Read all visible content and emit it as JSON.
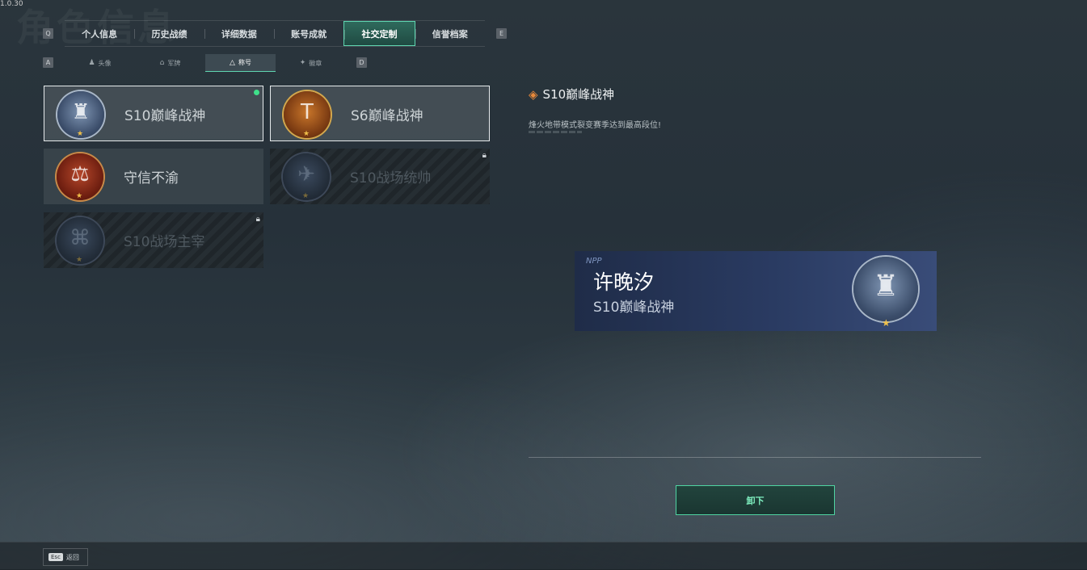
{
  "corner_text": "1.0.30",
  "ghost_title": "角色信息",
  "tab_keys": {
    "left": "Q",
    "right": "E"
  },
  "subtab_keys": {
    "left": "A",
    "right": "D"
  },
  "tabs": [
    {
      "label": "个人信息",
      "active": false
    },
    {
      "label": "历史战绩",
      "active": false
    },
    {
      "label": "详细数据",
      "active": false
    },
    {
      "label": "账号成就",
      "active": false
    },
    {
      "label": "社交定制",
      "active": true
    },
    {
      "label": "信誉档案",
      "active": false
    }
  ],
  "subtabs": [
    {
      "label": "头像",
      "icon": "person-icon",
      "glyph": "♟",
      "active": false
    },
    {
      "label": "军牌",
      "icon": "dogtag-icon",
      "glyph": "⌂",
      "active": false
    },
    {
      "label": "称号",
      "icon": "triangle-icon",
      "glyph": "△",
      "active": true
    },
    {
      "label": "徽章",
      "icon": "wings-icon",
      "glyph": "✦",
      "active": false
    }
  ],
  "titles": [
    {
      "name": "S10巅峰战神",
      "badge": "badge-blue",
      "glyph": "♜",
      "equipped": true,
      "locked": false,
      "selected": true
    },
    {
      "name": "S6巅峰战神",
      "badge": "badge-gold",
      "glyph": "T",
      "equipped": false,
      "locked": false,
      "selected": true
    },
    {
      "name": "守信不渝",
      "badge": "badge-red",
      "glyph": "⚖",
      "equipped": false,
      "locked": false,
      "selected": false
    },
    {
      "name": "S10战场统帅",
      "badge": "badge-dark",
      "glyph": "✈",
      "equipped": false,
      "locked": true,
      "selected": false
    },
    {
      "name": "S10战场主宰",
      "badge": "badge-dark",
      "glyph": "⌘",
      "equipped": false,
      "locked": true,
      "selected": false
    }
  ],
  "detail": {
    "title": "S10巅峰战神",
    "icon": "diamond-icon",
    "description": "烽火地带模式裂变赛季达到最高段位!"
  },
  "banner": {
    "logo": "NPP",
    "player_name": "许晚汐",
    "title": "S10巅峰战神"
  },
  "unequip_button": "卸下",
  "footer": {
    "esc_key": "Esc",
    "back_label": "返回"
  }
}
